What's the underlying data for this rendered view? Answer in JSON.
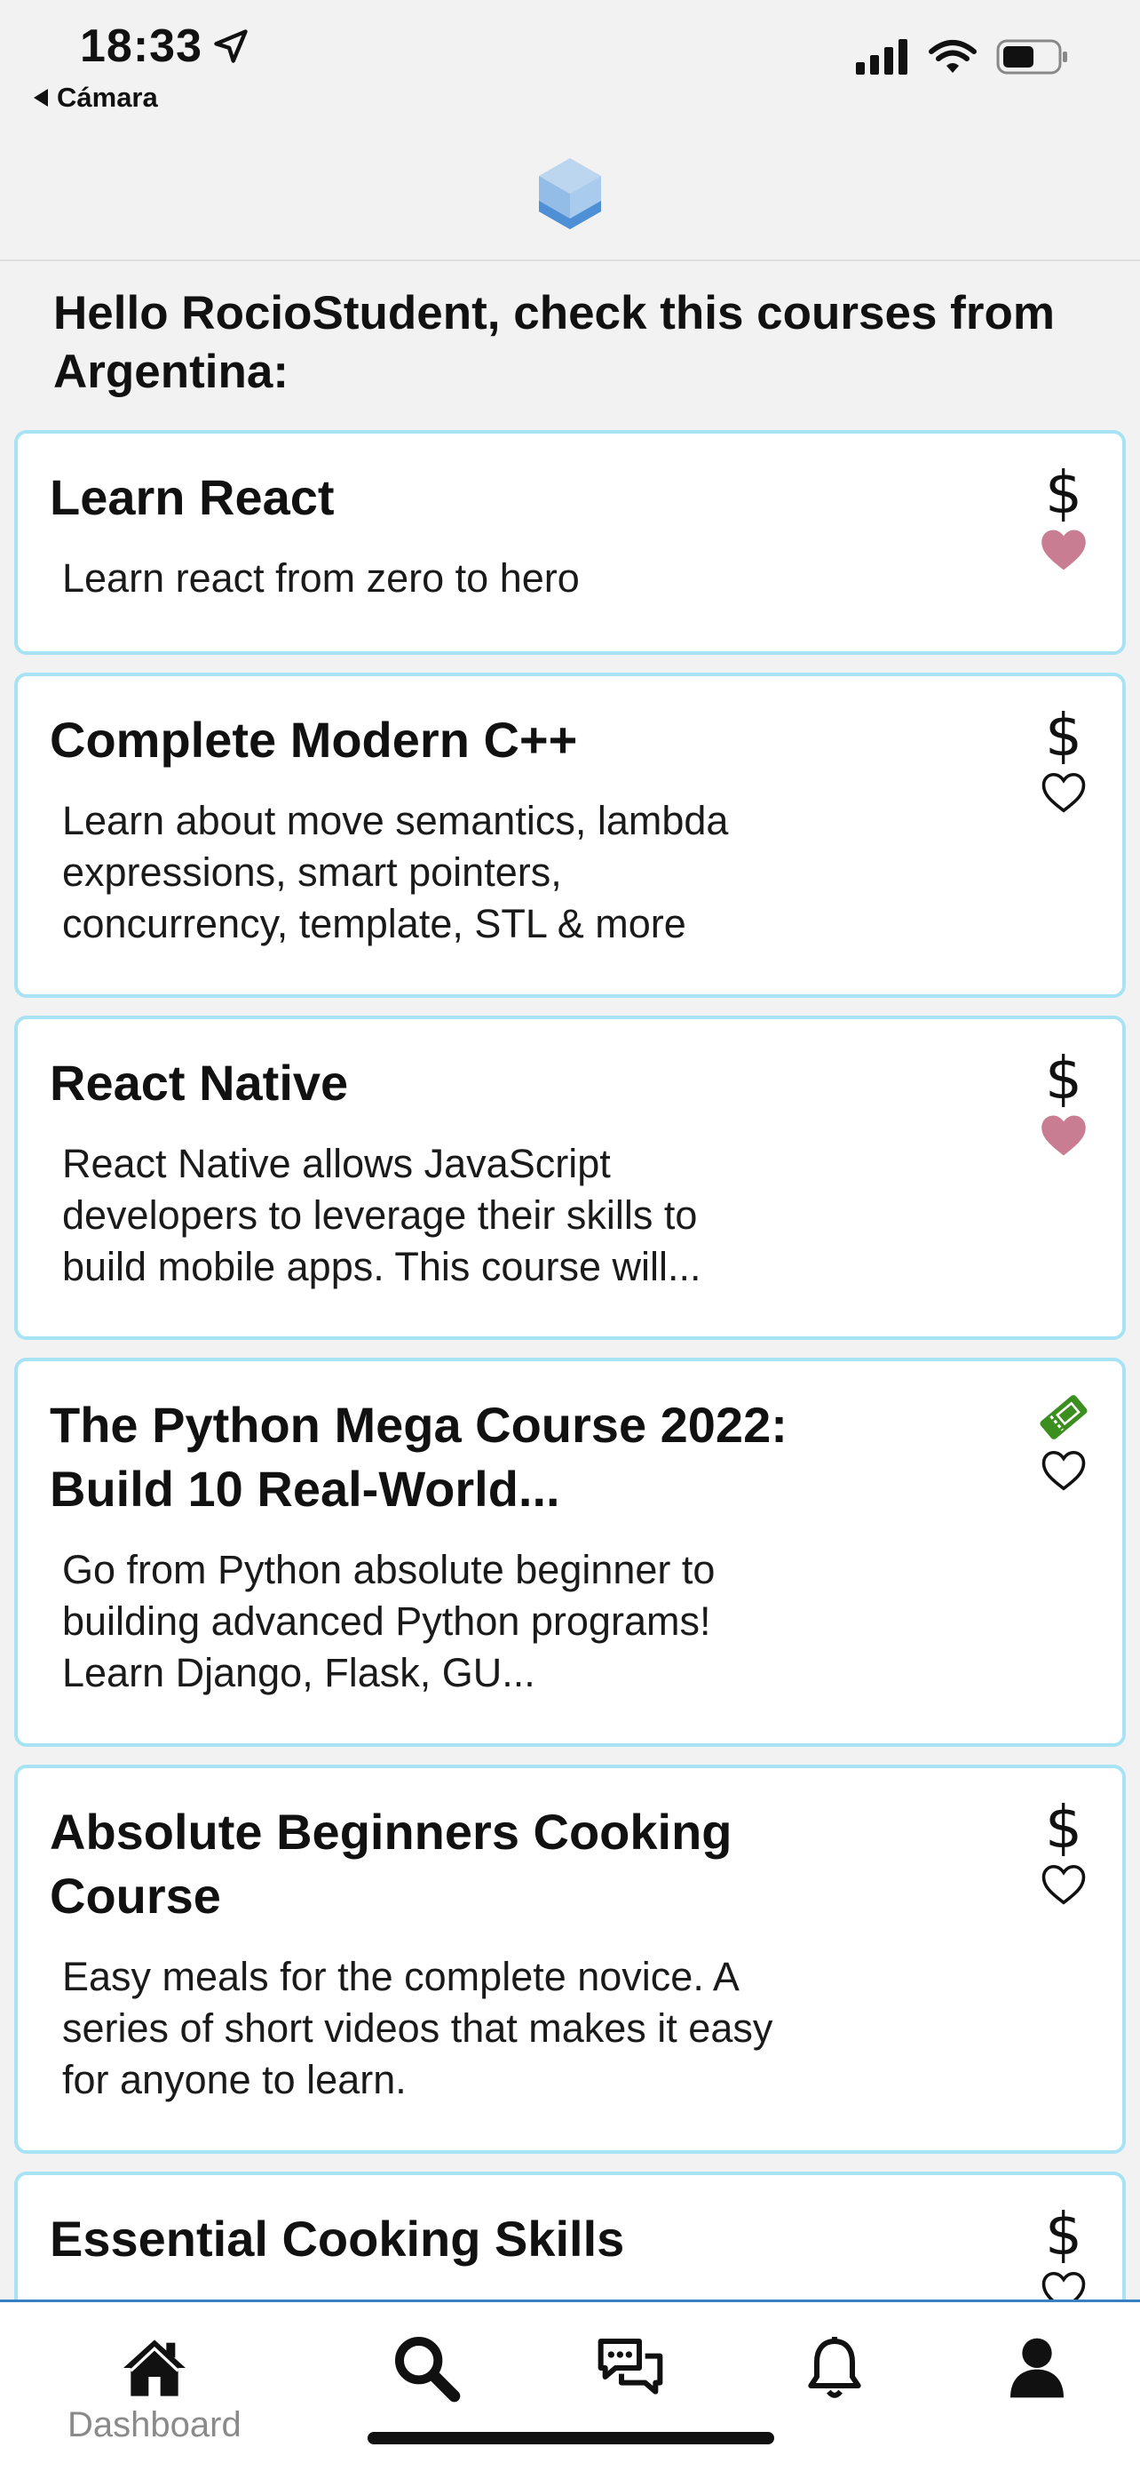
{
  "status_bar": {
    "time": "18:33",
    "back_app": "Cámara"
  },
  "greeting": "Hello RocioStudent, check this courses from Argentina:",
  "colors": {
    "card_border": "#a7e3f5",
    "favorite_heart": "#c97d92",
    "free_ticket": "#3b8f1e",
    "tab_divider": "#3a7fc2"
  },
  "courses": [
    {
      "title": "Learn React",
      "description": "Learn react from zero to hero",
      "price_icon": "$",
      "favorite": true
    },
    {
      "title": "Complete Modern C++",
      "description": "Learn about move semantics, lambda expressions, smart pointers, concurrency, template, STL & more",
      "price_icon": "$",
      "favorite": false
    },
    {
      "title": "React Native",
      "description": "React Native allows JavaScript developers to leverage their skills to build mobile apps. This course will...",
      "price_icon": "$",
      "favorite": true
    },
    {
      "title": "The Python Mega Course 2022: Build 10 Real-World...",
      "description": "Go from Python absolute beginner to building advanced Python programs! Learn Django, Flask, GU...",
      "price_icon": "ticket-icon",
      "favorite": false
    },
    {
      "title": "Absolute Beginners Cooking Course",
      "description": "Easy meals for the complete novice. A series of short videos that makes it easy for anyone to learn.",
      "price_icon": "$",
      "favorite": false
    },
    {
      "title": "Essential Cooking Skills",
      "description": "",
      "price_icon": "$",
      "favorite": false
    }
  ],
  "tabs": [
    {
      "icon": "home-icon",
      "label": "Dashboard"
    },
    {
      "icon": "search-icon",
      "label": ""
    },
    {
      "icon": "chat-icon",
      "label": ""
    },
    {
      "icon": "bell-icon",
      "label": ""
    },
    {
      "icon": "user-icon",
      "label": ""
    }
  ]
}
